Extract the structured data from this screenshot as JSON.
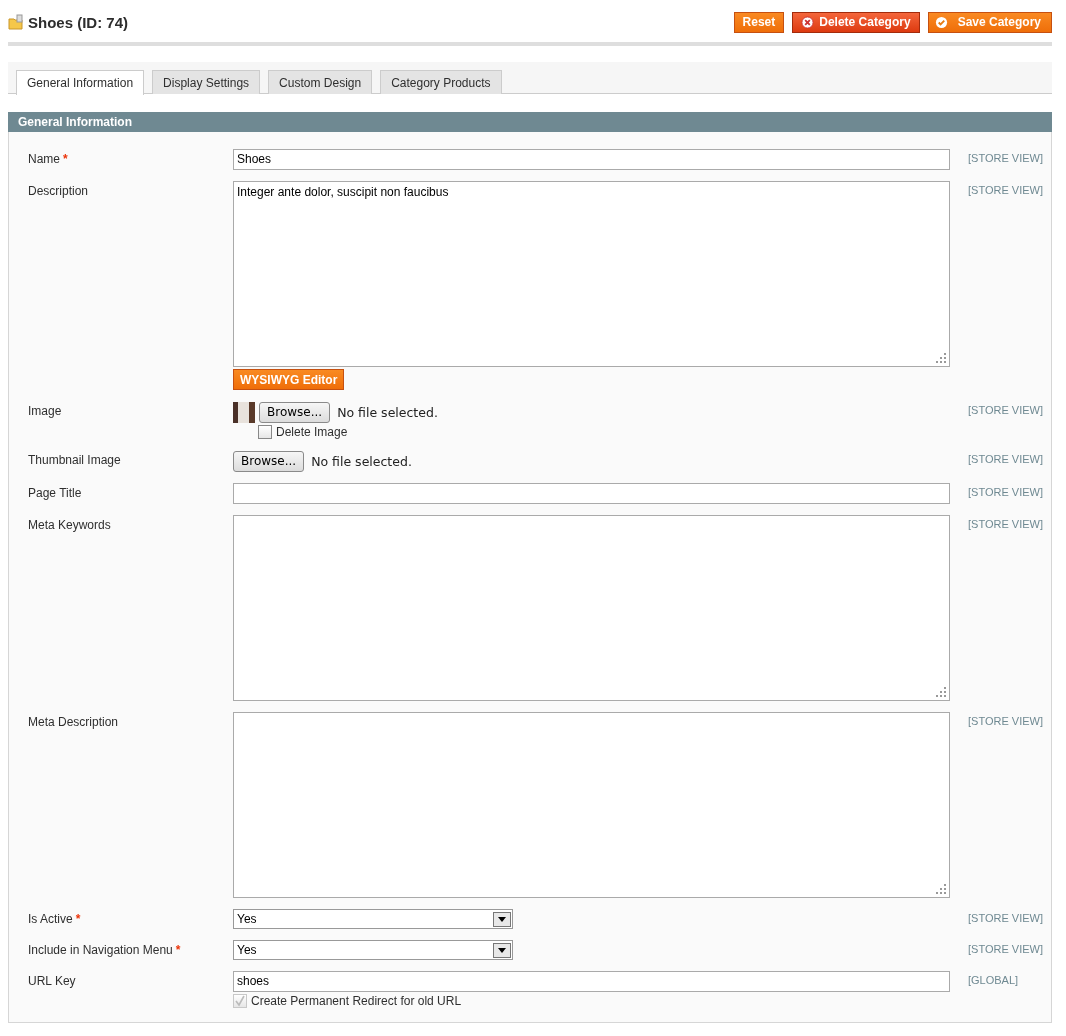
{
  "page": {
    "title": "Shoes (ID: 74)"
  },
  "actions": [
    {
      "label": "Reset",
      "kind": "plain"
    },
    {
      "label": "Delete Category",
      "kind": "delete"
    },
    {
      "label": "Save Category",
      "kind": "save"
    }
  ],
  "tabs": [
    {
      "label": "General Information",
      "selected": true
    },
    {
      "label": "Display Settings",
      "selected": false
    },
    {
      "label": "Custom Design",
      "selected": false
    },
    {
      "label": "Category Products",
      "selected": false
    }
  ],
  "section": {
    "title": "General Information"
  },
  "fields": [
    {
      "kind": "text",
      "label": "Name",
      "required_mark": "*",
      "value": "Shoes",
      "scope": "[STORE VIEW]"
    },
    {
      "kind": "textarea",
      "label": "Description",
      "value": "Integer ante dolor, suscipit non faucibus",
      "scope": "[STORE VIEW]",
      "button": "WYSIWYG Editor"
    },
    {
      "kind": "image",
      "label": "Image",
      "browse": "Browse...",
      "status": "No file selected.",
      "scope": "[STORE VIEW]",
      "checkbox": {
        "label": "Delete Image",
        "checked": false,
        "disabled": false
      }
    },
    {
      "kind": "file",
      "label": "Thumbnail Image",
      "browse": "Browse...",
      "status": "No file selected.",
      "scope": "[STORE VIEW]"
    },
    {
      "kind": "text",
      "label": "Page Title",
      "scope": "[STORE VIEW]"
    },
    {
      "kind": "textarea",
      "label": "Meta Keywords",
      "scope": "[STORE VIEW]"
    },
    {
      "kind": "textarea",
      "label": "Meta Description",
      "scope": "[STORE VIEW]"
    },
    {
      "kind": "select",
      "label": "Is Active",
      "required_mark": "*",
      "value": "Yes",
      "scope": "[STORE VIEW]"
    },
    {
      "kind": "select",
      "label": "Include in Navigation Menu",
      "required_mark": "*",
      "value": "Yes",
      "scope": "[STORE VIEW]"
    },
    {
      "kind": "text",
      "label": "URL Key",
      "value": "shoes",
      "scope": "[GLOBAL]",
      "checkbox": {
        "label": "Create Permanent Redirect for old URL",
        "checked": true,
        "disabled": true
      }
    }
  ]
}
